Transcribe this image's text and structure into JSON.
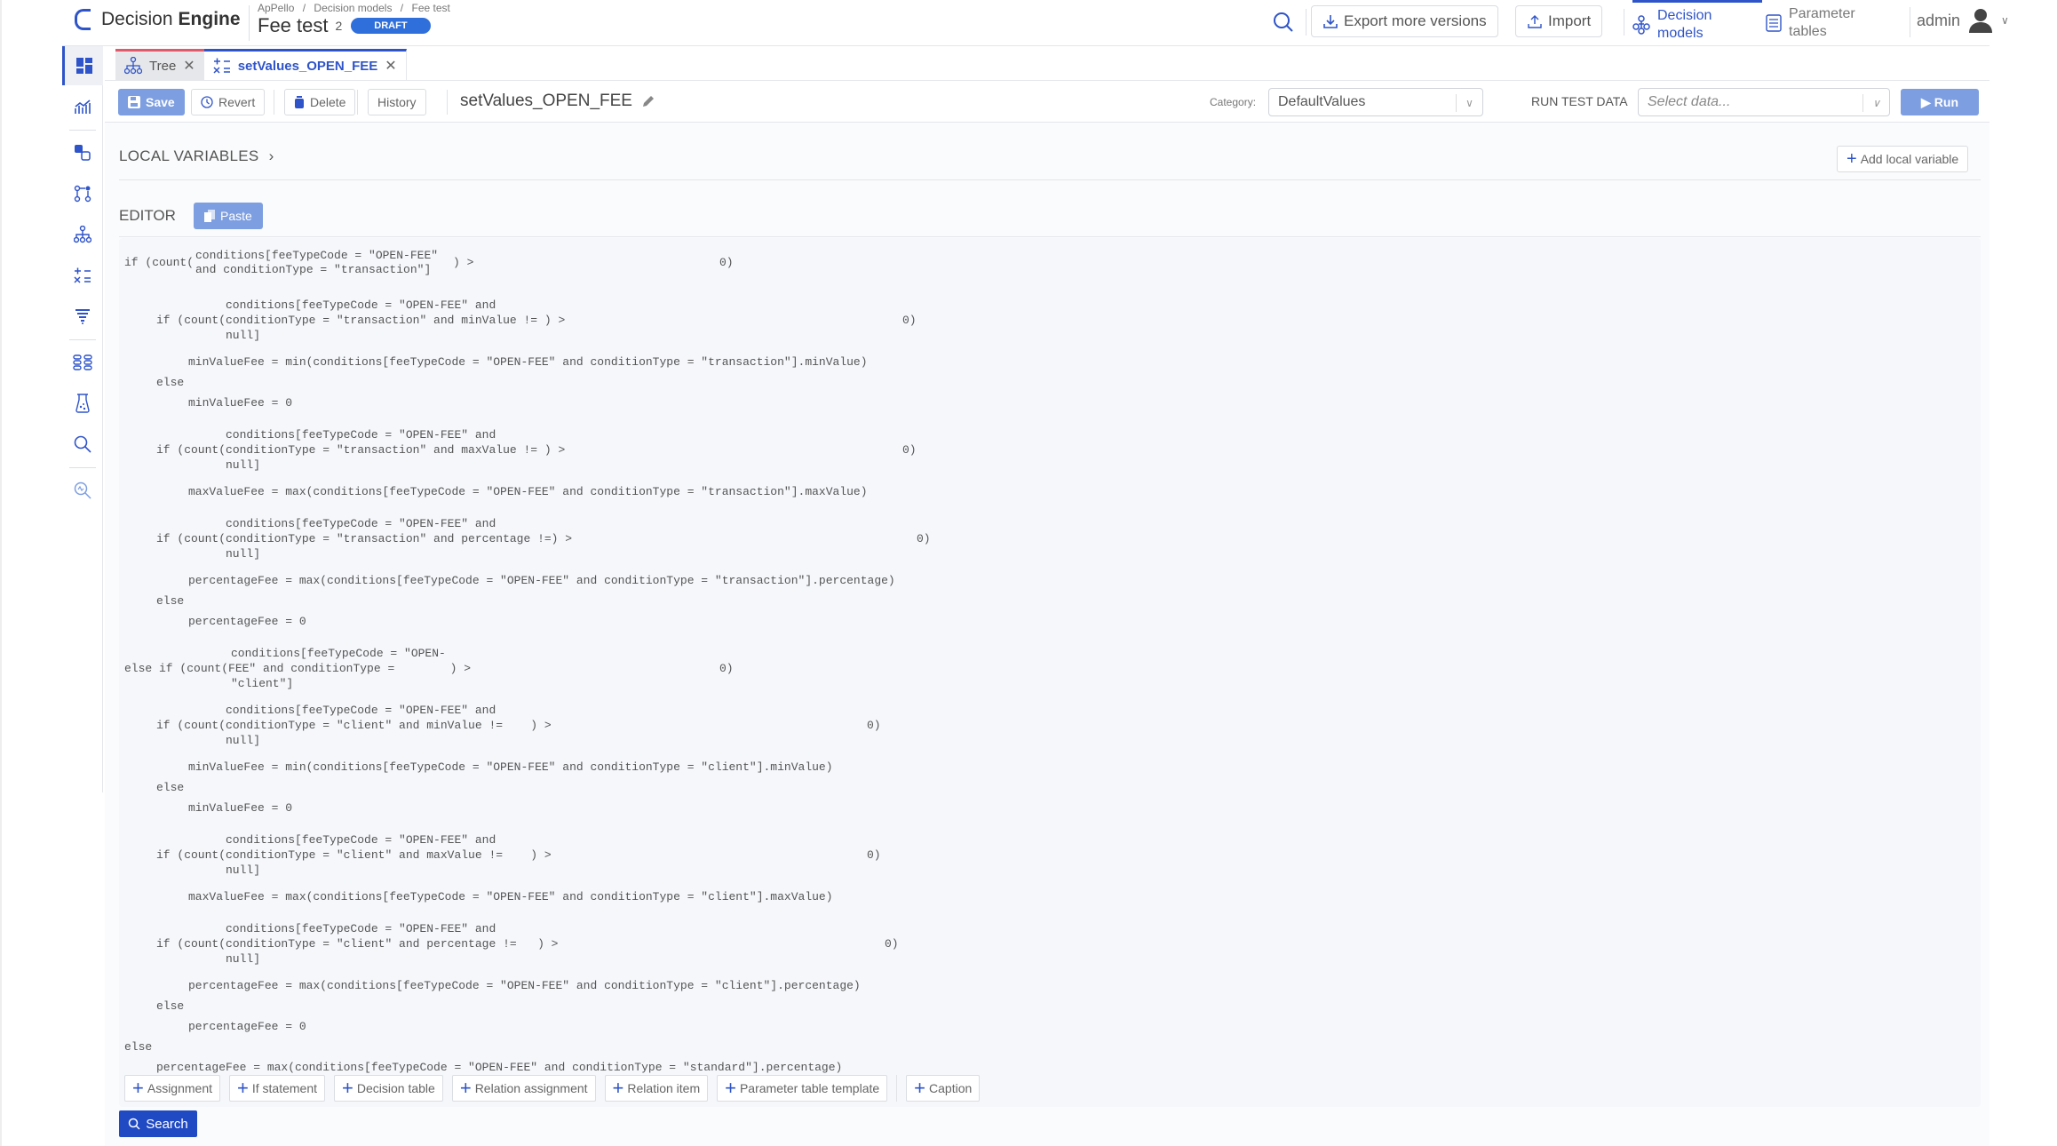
{
  "header": {
    "app_name_light": "Decision",
    "app_name_bold": "Engine",
    "breadcrumb": [
      "ApPello",
      "/",
      "Decision models",
      "/",
      "Fee test"
    ],
    "doc_title": "Fee test",
    "version": "2",
    "status_badge": "DRAFT",
    "export_label": "Export more versions",
    "import_label": "Import",
    "nav": [
      {
        "line1": "Decision",
        "line2": "models",
        "active": true
      },
      {
        "line1": "Parameter",
        "line2": "tables",
        "active": false
      }
    ],
    "user": "admin"
  },
  "sidebar": {
    "items": [
      "dashboard",
      "analytics",
      "data-objects",
      "flows",
      "decision-tree",
      "calculations",
      "filters",
      "relations",
      "test-lab",
      "search",
      "advanced-search"
    ]
  },
  "tabs": [
    {
      "label": "Tree",
      "icon": "tree-icon"
    },
    {
      "label": "setValues_OPEN_FEE",
      "icon": "calculation-icon",
      "active": true
    }
  ],
  "toolbar": {
    "save": "Save",
    "revert": "Revert",
    "delete": "Delete",
    "history": "History",
    "element_title": "setValues_OPEN_FEE",
    "category_label": "Category:",
    "category_value": "DefaultValues",
    "run_test_data_label": "RUN TEST DATA",
    "run_test_data_placeholder": "Select data...",
    "run": "Run"
  },
  "local_variables": {
    "label": "LOCAL VARIABLES",
    "add_button": "Add local variable"
  },
  "editor": {
    "label": "EDITOR",
    "paste": "Paste",
    "code_lines": [
      {
        "text": "         conditions[feeTypeCode = \"OPEN-FEE\"",
        "indent": 0
      },
      {
        "text": "if (count(and conditionType = \"transaction\"] ) >                      0)",
        "indent": 0
      },
      {
        "text": "",
        "indent": 0
      },
      {
        "text": "conditions[feeTypeCode = \"OPEN-FEE\" and",
        "indent": 0
      },
      {
        "text": "if (count(conditionType = \"transaction\" and minValue != ) >",
        "indent": 0
      },
      {
        "text": "null]",
        "indent": 0
      },
      {
        "text": "minValueFee = min(conditions[feeTypeCode = \"OPEN-FEE\" and conditionType = \"transaction\"].minValue)",
        "indent": 0
      },
      {
        "text": "else",
        "indent": 0
      },
      {
        "text": "minValueFee = 0",
        "indent": 0
      }
    ],
    "blocks": [
      {
        "type": "if3",
        "a": "conditions[feeTypeCode = \"OPEN-FEE\"",
        "b": "and conditionType = \"transaction\"]",
        "pre": "if (count(",
        "post": ") >",
        "zero": "0)"
      },
      {
        "type": "if",
        "l1": "conditions[feeTypeCode = \"OPEN-FEE\" and",
        "l2": "if (count(conditionType = \"transaction\" and minValue != ) >",
        "l3": "null]",
        "zero": "0)"
      },
      {
        "type": "stmt",
        "text": "minValueFee = min(conditions[feeTypeCode = \"OPEN-FEE\" and conditionType = \"transaction\"].minValue)"
      },
      {
        "type": "else",
        "text": "else"
      },
      {
        "type": "stmt",
        "text": "minValueFee = 0"
      },
      {
        "type": "if",
        "l1": "conditions[feeTypeCode = \"OPEN-FEE\" and",
        "l2": "if (count(conditionType = \"transaction\" and maxValue != ) >",
        "l3": "null]",
        "zero": "0)"
      },
      {
        "type": "stmt",
        "text": "maxValueFee = max(conditions[feeTypeCode = \"OPEN-FEE\" and conditionType = \"transaction\"].maxValue)"
      },
      {
        "type": "if",
        "l1": "conditions[feeTypeCode = \"OPEN-FEE\" and",
        "l2": "if (count(conditionType = \"transaction\" and percentage !=) >",
        "l3": "null]",
        "zero": "0)"
      },
      {
        "type": "stmt",
        "text": "percentageFee = max(conditions[feeTypeCode = \"OPEN-FEE\" and conditionType = \"transaction\"].percentage)"
      },
      {
        "type": "else",
        "text": "else"
      },
      {
        "type": "stmt",
        "text": "percentageFee = 0"
      },
      {
        "type": "elseif",
        "l1": "conditions[feeTypeCode = \"OPEN-",
        "l2": "else if (count(FEE\" and conditionType =        ) >",
        "l3": "\"client\"]",
        "zero": "0)"
      },
      {
        "type": "if",
        "l1": "conditions[feeTypeCode = \"OPEN-FEE\" and",
        "l2": "if (count(conditionType = \"client\" and minValue !=    ) >",
        "l3": "null]",
        "zero": "0)"
      },
      {
        "type": "stmt",
        "text": "minValueFee = min(conditions[feeTypeCode = \"OPEN-FEE\" and conditionType = \"client\"].minValue)"
      },
      {
        "type": "else",
        "text": "else"
      },
      {
        "type": "stmt",
        "text": "minValueFee = 0"
      },
      {
        "type": "if",
        "l1": "conditions[feeTypeCode = \"OPEN-FEE\" and",
        "l2": "if (count(conditionType = \"client\" and maxValue !=    ) >",
        "l3": "null]",
        "zero": "0)"
      },
      {
        "type": "stmt",
        "text": "maxValueFee = max(conditions[feeTypeCode = \"OPEN-FEE\" and conditionType = \"client\"].maxValue)"
      },
      {
        "type": "if",
        "l1": "conditions[feeTypeCode = \"OPEN-FEE\" and",
        "l2": "if (count(conditionType = \"client\" and percentage !=   ) >",
        "l3": "null]",
        "zero": "0)"
      },
      {
        "type": "stmt",
        "text": "percentageFee = max(conditions[feeTypeCode = \"OPEN-FEE\" and conditionType = \"client\"].percentage)"
      },
      {
        "type": "else",
        "text": "else"
      },
      {
        "type": "stmt",
        "text": "percentageFee = 0"
      },
      {
        "type": "else",
        "text": "else"
      },
      {
        "type": "stmt",
        "text": "percentageFee = max(conditions[feeTypeCode = \"OPEN-FEE\" and conditionType = \"standard\"].percentage)"
      }
    ],
    "add_buttons": [
      "Assignment",
      "If statement",
      "Decision table",
      "Relation assignment",
      "Relation item",
      "Parameter table template",
      "Caption"
    ]
  },
  "search_button": "Search",
  "colors": {
    "accent": "#2f54c9",
    "draft": "#2f6fdb",
    "tree_tab": "#e05a6b",
    "disabled_primary": "#7d9ee0"
  }
}
